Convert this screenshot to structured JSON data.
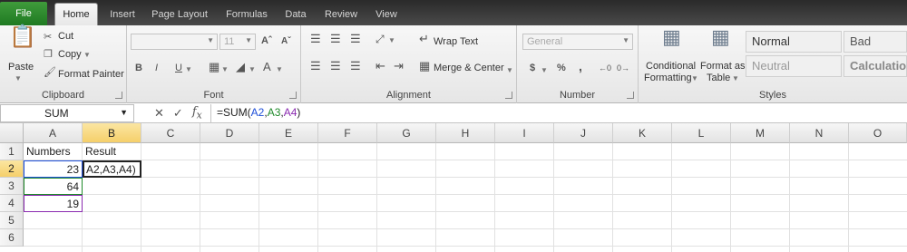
{
  "tabs": {
    "file": "File",
    "items": [
      "Home",
      "Insert",
      "Page Layout",
      "Formulas",
      "Data",
      "Review",
      "View"
    ],
    "active": "Home"
  },
  "ribbon": {
    "clipboard": {
      "label": "Clipboard",
      "paste": "Paste",
      "cut": "Cut",
      "copy": "Copy",
      "format_painter": "Format Painter"
    },
    "font": {
      "label": "Font",
      "font_name": "",
      "font_size": "11",
      "bold": "B",
      "italic": "I",
      "underline": "U"
    },
    "alignment": {
      "label": "Alignment",
      "wrap_text": "Wrap Text",
      "merge_center": "Merge & Center"
    },
    "number": {
      "label": "Number",
      "format": "General",
      "currency": "$",
      "percent": "%",
      "comma": ","
    },
    "styles": {
      "label": "Styles",
      "conditional_formatting_line1": "Conditional",
      "conditional_formatting_line2": "Formatting",
      "format_as_table_line1": "Format as",
      "format_as_table_line2": "Table",
      "normal": "Normal",
      "bad": "Bad",
      "neutral": "Neutral",
      "calculation": "Calculation"
    }
  },
  "formula_bar": {
    "name_box": "SUM",
    "formula_prefix": "=SUM(",
    "ref1": "A2",
    "ref2": "A3",
    "ref3": "A4",
    "formula_suffix": ")",
    "colors": {
      "ref1": "#1e4fd8",
      "ref2": "#1f8a2a",
      "ref3": "#8a2ab0"
    }
  },
  "grid": {
    "columns": [
      "A",
      "B",
      "C",
      "D",
      "E",
      "F",
      "G",
      "H",
      "I",
      "J",
      "K",
      "L",
      "M",
      "N",
      "O"
    ],
    "rows": [
      "1",
      "2",
      "3",
      "4",
      "5",
      "6"
    ],
    "selected_column": "B",
    "selected_row": "2",
    "cells": {
      "A1": "Numbers",
      "B1": "Result",
      "A2": "23",
      "B2": "A2,A3,A4)",
      "A3": "64",
      "A4": "19"
    }
  }
}
